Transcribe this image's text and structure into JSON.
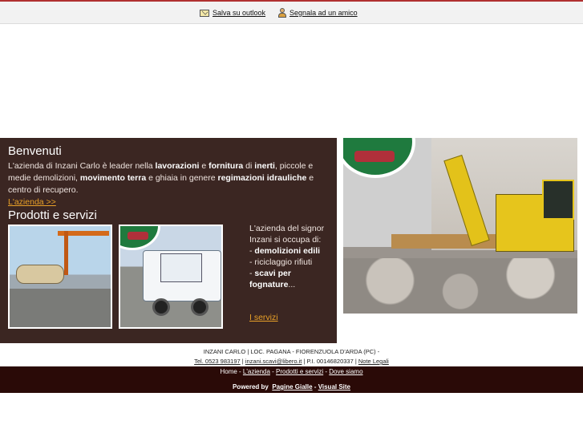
{
  "toolbar": {
    "save_outlook": "Salva su outlook",
    "report_friend": "Segnala ad un amico"
  },
  "welcome": {
    "title": "Benvenuti",
    "t1": "L'azienda di Inzani Carlo è leader nella ",
    "b1": "lavorazioni",
    "t2": " e ",
    "b2": "fornitura",
    "t3": " di ",
    "b3": "inerti",
    "t4": ", piccole e medie demolizioni, ",
    "b4": "movimento terra",
    "t5": " e ghiaia in genere ",
    "b5": "regimazioni idrauliche",
    "t6": " e centro di recupero.",
    "link": "L'azienda >>"
  },
  "products": {
    "title": "Prodotti e servizi",
    "intro": "L'azienda del signor Inzani si occupa di:",
    "items": [
      {
        "prefix": "- ",
        "text": "demolizioni edili",
        "bold": true
      },
      {
        "prefix": "- ",
        "text": "riciclaggio rifiuti",
        "bold": false
      },
      {
        "prefix": "- ",
        "text": "scavi per fognature",
        "bold": true
      }
    ],
    "ellipsis": "...",
    "link": "I servizi"
  },
  "footer": {
    "line1": "INZANI CARLO | LOC. PAGANA - FIORENZUOLA D'ARDA (PC) -",
    "tel": "Tel. 0523 983197",
    "sep1": " | ",
    "email": "inzani.scavi@libero.it",
    "piva": " | P.I. 00146820337 | ",
    "legal": "Note Legali",
    "nav": [
      "Home",
      "L'azienda",
      "Prodotti e servizi",
      "Dove siamo"
    ],
    "nav_sep": " - ",
    "powered_label": "Powered by",
    "powered_links": [
      "Pagine Gialle",
      "Visual Site"
    ],
    "powered_sep": " - "
  },
  "colors": {
    "panel_bg": "#3b2622",
    "accent_orange": "#e9a128",
    "footer_bg": "#2a0a07",
    "badge_green": "#1f7a3e"
  }
}
